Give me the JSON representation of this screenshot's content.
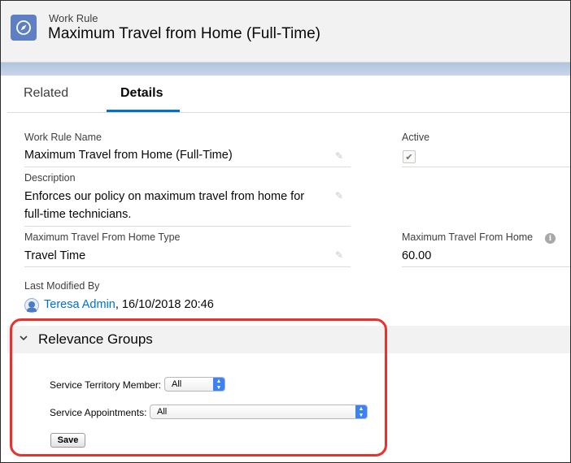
{
  "header": {
    "record_type": "Work Rule",
    "record_title": "Maximum Travel from Home (Full-Time)"
  },
  "tabs": [
    {
      "label": "Related"
    },
    {
      "label": "Details",
      "active": true
    }
  ],
  "fields": {
    "work_rule_name": {
      "label": "Work Rule Name",
      "value": "Maximum Travel from Home (Full-Time)"
    },
    "active": {
      "label": "Active",
      "checked": true
    },
    "description": {
      "label": "Description",
      "value_line1": "Enforces our policy on maximum travel from home for",
      "value_line2": "full-time technicians."
    },
    "travel_type": {
      "label": "Maximum Travel From Home Type",
      "value": "Travel Time"
    },
    "max_travel": {
      "label": "Maximum Travel From Home",
      "value": "60.00"
    },
    "last_modified": {
      "label": "Last Modified By",
      "user": "Teresa Admin",
      "timestamp": ", 16/10/2018 20:46"
    }
  },
  "section": {
    "title": "Relevance Groups",
    "territory_label": "Service Territory Member:",
    "territory_value": "All",
    "appointments_label": "Service Appointments:",
    "appointments_value": "All",
    "save_label": "Save"
  },
  "colors": {
    "brand_blue": "#0070d2",
    "highlight_red": "#e8322b",
    "icon_blue": "#5e7fc3"
  }
}
